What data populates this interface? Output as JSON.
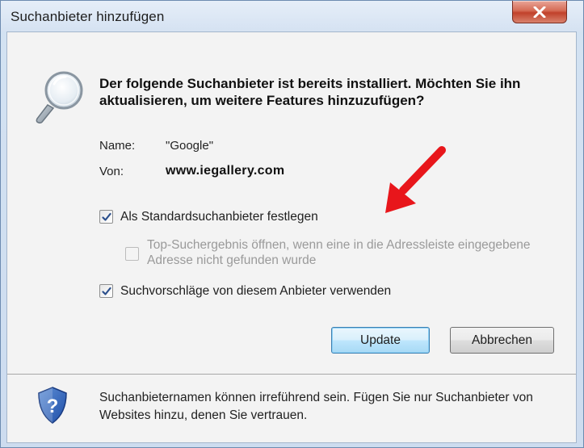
{
  "window": {
    "title": "Suchanbieter hinzufügen",
    "close_icon": "close-icon"
  },
  "dialog": {
    "heading": "Der folgende Suchanbieter ist bereits installiert. Möchten Sie ihn aktualisieren, um weitere Features hinzuzufügen?",
    "name_label": "Name:",
    "name_value": "\"Google\"",
    "from_label": "Von:",
    "from_value": "www.iegallery.com",
    "options": [
      {
        "label": "Als Standardsuchanbieter festlegen",
        "checked": true,
        "enabled": true
      },
      {
        "label": "Top-Suchergebnis öffnen, wenn eine in die Adressleiste eingegebene Adresse nicht gefunden wurde",
        "checked": false,
        "enabled": false
      },
      {
        "label": "Suchvorschläge von diesem Anbieter verwenden",
        "checked": true,
        "enabled": true
      }
    ],
    "update_button": "Update",
    "cancel_button": "Abbrechen"
  },
  "footer": {
    "text": "Suchanbieternamen können irreführend sein. Fügen Sie nur Suchanbieter von Websites hinzu, denen Sie vertrauen."
  },
  "colors": {
    "annotation_arrow": "#e8161b",
    "close_button": "#c7442c",
    "default_button_border": "#3c7fb1"
  },
  "icons": [
    "search-icon",
    "shield-question-icon",
    "checkmark-icon",
    "red-arrow-annotation"
  ]
}
